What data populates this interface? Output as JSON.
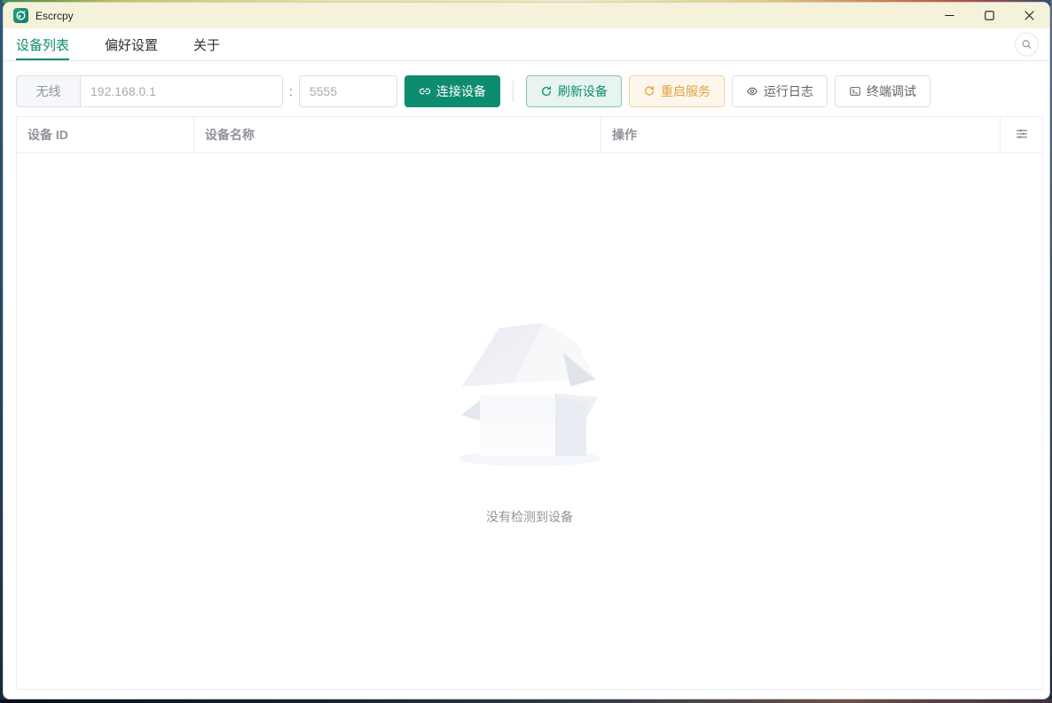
{
  "window": {
    "title": "Escrcpy"
  },
  "tabs": [
    {
      "label": "设备列表",
      "active": true
    },
    {
      "label": "偏好设置",
      "active": false
    },
    {
      "label": "关于",
      "active": false
    }
  ],
  "toolbar": {
    "wireless_label": "无线",
    "ip_placeholder": "192.168.0.1",
    "ip_value": "",
    "port_separator": ":",
    "port_placeholder": "5555",
    "port_value": "",
    "connect_label": "连接设备",
    "refresh_label": "刷新设备",
    "restart_label": "重启服务",
    "logs_label": "运行日志",
    "terminal_label": "终端调试"
  },
  "table": {
    "columns": [
      "设备 ID",
      "设备名称",
      "操作"
    ],
    "rows": [],
    "empty_text": "没有检测到设备"
  },
  "icons": {
    "app_logo": "escrcpy-logo",
    "minimize": "horizontal-line",
    "maximize": "square-outline",
    "close": "x-cross",
    "search": "magnifier",
    "connect": "chain-link",
    "refresh": "circular-arrows",
    "restart": "restart-arrow",
    "logs": "eye",
    "terminal": "monitor",
    "column_settings": "sliders"
  },
  "colors": {
    "primary": "#0e8c6f",
    "warning": "#e6a23c",
    "titlebar_bg": "#f6f2d9",
    "border": "#dcdfe6",
    "table_border": "#ebeef5",
    "muted_text": "#909399"
  }
}
